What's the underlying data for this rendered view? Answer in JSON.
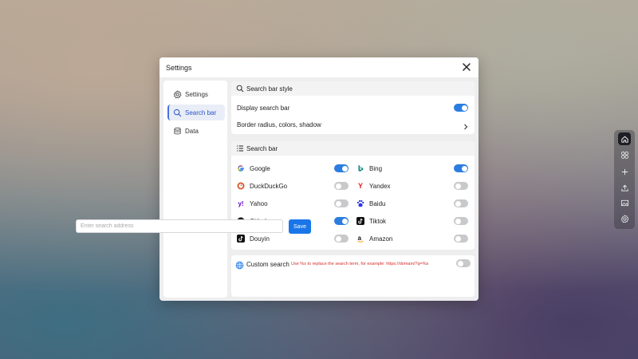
{
  "dialog": {
    "title": "Settings"
  },
  "sidebar": {
    "items": [
      {
        "label": "Settings",
        "icon": "gear-icon"
      },
      {
        "label": "Search bar",
        "icon": "search-icon",
        "active": true
      },
      {
        "label": "Data",
        "icon": "database-icon"
      }
    ]
  },
  "style_panel": {
    "title": "Search bar style",
    "display_label": "Display search bar",
    "display_on": true,
    "border_label": "Border radius, colors, shadow"
  },
  "engines_panel": {
    "title": "Search bar",
    "engines": [
      {
        "name": "Google",
        "on": true
      },
      {
        "name": "Bing",
        "on": true
      },
      {
        "name": "DuckDuckGo",
        "on": false
      },
      {
        "name": "Yandex",
        "on": false
      },
      {
        "name": "Yahoo",
        "on": false
      },
      {
        "name": "Baidu",
        "on": false
      },
      {
        "name": "Github",
        "on": true
      },
      {
        "name": "Tiktok",
        "on": false
      },
      {
        "name": "Douyin",
        "on": false
      },
      {
        "name": "Amazon",
        "on": false
      }
    ]
  },
  "custom_panel": {
    "title": "Custom search",
    "hint": "Use %s to replace the search term, for example: https://domain/?q=%s",
    "on": false,
    "placeholder": "Enter search address",
    "save_label": "Save"
  },
  "dock": {
    "items": [
      "home-icon",
      "apps-icon",
      "plus-icon",
      "upload-icon",
      "image-icon",
      "gear-icon"
    ]
  },
  "colors": {
    "accent": "#1976e8",
    "hint": "#d0312d"
  }
}
